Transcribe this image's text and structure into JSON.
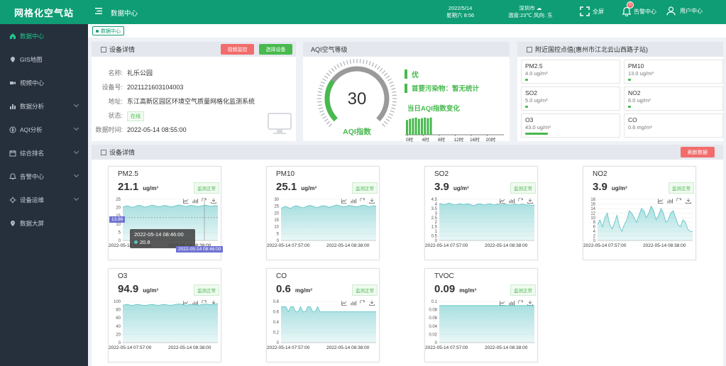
{
  "app": {
    "title": "网格化空气站"
  },
  "sidebar": {
    "items": [
      {
        "label": "数据中心",
        "icon": "home-icon",
        "active": true,
        "arrow": false
      },
      {
        "label": "GIS地图",
        "icon": "map-icon",
        "active": false,
        "arrow": false
      },
      {
        "label": "视频中心",
        "icon": "video-icon",
        "active": false,
        "arrow": false
      },
      {
        "label": "数据分析",
        "icon": "bar-chart-icon",
        "active": false,
        "arrow": true
      },
      {
        "label": "AQI分析",
        "icon": "compass-icon",
        "active": false,
        "arrow": true
      },
      {
        "label": "综合排名",
        "icon": "calendar-icon",
        "active": false,
        "arrow": true
      },
      {
        "label": "告警中心",
        "icon": "bell-icon",
        "active": false,
        "arrow": true
      },
      {
        "label": "设备运维",
        "icon": "settings-icon",
        "active": false,
        "arrow": true
      },
      {
        "label": "数据大屏",
        "icon": "location-icon",
        "active": false,
        "arrow": false
      }
    ]
  },
  "topbar": {
    "page_title": "数据中心",
    "date": "2022/5/14",
    "weekday_time": "星期六 8:56",
    "city": "深圳市",
    "weather": "温度:23℃ 风向: 东",
    "fullscreen_label": "全屏",
    "alarm_label": "告警中心",
    "alarm_count": "0",
    "user_label": "用户中心"
  },
  "breadcrumb": {
    "label": "数据中心"
  },
  "device": {
    "title": "设备详情",
    "btn_video": "视频监控",
    "btn_select": "选择设备",
    "rows": [
      {
        "k": "名称:",
        "v": "礼乐公园"
      },
      {
        "k": "设备号:",
        "v": "2021121603104003"
      },
      {
        "k": "地址:",
        "v": "东江高新区园区环境空气质量网格化监测系统"
      },
      {
        "k": "状态:",
        "v": "在线"
      },
      {
        "k": "数据时间:",
        "v": "2022-05-14 08:55:00"
      }
    ]
  },
  "aqi": {
    "title": "AQI空气等级",
    "value": "30",
    "label": "AQI指数",
    "level": "优",
    "pollutant": "首要污染物：暂无统计",
    "today_title": "当日AQI指数变化",
    "today_values": [
      24,
      26,
      27,
      28,
      26,
      27,
      28,
      27,
      28
    ],
    "ticks": [
      "0时",
      "4时",
      "8时",
      "12时",
      "16时",
      "20时"
    ],
    "gauge_fraction": 0.3,
    "colors": {
      "green": "#48b94e",
      "gray": "#9a9a9a"
    }
  },
  "national": {
    "title": "附近国控点值(惠州市江北云山西路子站)",
    "items": [
      {
        "name": "PM2.5",
        "value": "4.0 ug/m³",
        "level": 0.03
      },
      {
        "name": "PM10",
        "value": "13.0 ug/m³",
        "level": 0.03
      },
      {
        "name": "SO2",
        "value": "5.0 ug/m³",
        "level": 0.03
      },
      {
        "name": "NO2",
        "value": "6.0 ug/m³",
        "level": 0.03
      },
      {
        "name": "O3",
        "value": "43.0 ug/m³",
        "level": 0.25
      },
      {
        "name": "CO",
        "value": "0.6 mg/m³",
        "level": 0.0
      }
    ]
  },
  "details": {
    "title": "设备详情",
    "refresh": "刷新数据",
    "status_label": "监测正常",
    "x_start": "2022-05-14 07:57:00",
    "x_end": "2022-05-14 08:38:00",
    "tooltip": {
      "time": "2022-05-14 08:46:00",
      "value": "20.8",
      "marker": "13.86",
      "axis_time": "2022-05-14 08:46:00"
    }
  },
  "chart_data": [
    {
      "type": "area",
      "name": "PM2.5",
      "value": "21.1",
      "unit": "ug/m³",
      "yticks": [
        "0",
        "5",
        "10",
        "15",
        "20",
        "25"
      ],
      "ylim": [
        0,
        25
      ],
      "values": [
        20.2,
        20.8,
        21.0,
        20.5,
        20.1,
        20.6,
        21.2,
        21.4,
        20.8,
        20.3,
        20.6,
        21.0,
        21.5,
        21.2,
        20.7,
        20.5,
        20.9,
        21.3,
        21.1,
        20.6,
        20.4,
        20.8,
        21.2,
        21.6,
        21.3,
        20.9,
        20.7,
        21.0,
        21.4,
        21.1,
        20.8,
        20.6,
        21.0,
        21.3,
        21.5,
        21.1,
        20.8,
        21.0,
        21.2,
        21.1
      ]
    },
    {
      "type": "area",
      "name": "PM10",
      "value": "25.1",
      "unit": "ug/m³",
      "yticks": [
        "0",
        "5",
        "10",
        "15",
        "20",
        "25",
        "30"
      ],
      "ylim": [
        0,
        30
      ],
      "values": [
        23.5,
        24.2,
        24.8,
        23.9,
        23.4,
        24.6,
        25.3,
        25.0,
        24.2,
        23.8,
        24.4,
        25.2,
        25.6,
        24.9,
        24.3,
        24.0,
        24.7,
        25.4,
        25.2,
        24.6,
        24.1,
        24.8,
        25.5,
        25.9,
        25.3,
        24.7,
        24.5,
        25.0,
        25.6,
        25.2,
        24.8,
        24.4,
        24.9,
        25.5,
        25.8,
        25.2,
        24.7,
        24.9,
        25.3,
        25.1
      ]
    },
    {
      "type": "area",
      "name": "SO2",
      "value": "3.9",
      "unit": "ug/m³",
      "yticks": [
        "0",
        "0.5",
        "1",
        "1.5",
        "2",
        "2.5",
        "3",
        "3.5",
        "4",
        "4.5"
      ],
      "ylim": [
        0,
        4.5
      ],
      "values": [
        4.0,
        4.0,
        3.9,
        4.0,
        4.1,
        4.0,
        3.9,
        3.9,
        4.0,
        4.0,
        3.9,
        4.0,
        4.0,
        3.9,
        3.8,
        3.9,
        4.0,
        4.0,
        3.9,
        3.9,
        4.0,
        4.0,
        3.9,
        3.9,
        4.0,
        3.9,
        3.9,
        4.0,
        3.9,
        3.9,
        3.9,
        4.0,
        3.9,
        3.9,
        4.0,
        3.9,
        3.9,
        3.9,
        3.8,
        3.9
      ]
    },
    {
      "type": "area",
      "name": "NO2",
      "value": "3.9",
      "unit": "ug/m³",
      "yticks": [
        "0",
        "2",
        "4",
        "6",
        "8",
        "10",
        "12",
        "14",
        "16",
        "18"
      ],
      "ylim": [
        0,
        18
      ],
      "values": [
        7,
        9,
        6,
        10,
        12,
        7,
        5,
        8,
        11,
        6,
        4,
        7,
        9,
        13,
        12,
        10,
        8,
        11,
        14,
        13,
        10,
        12,
        15,
        13,
        9,
        11,
        14,
        12,
        8,
        9,
        12,
        13,
        10,
        7,
        6,
        9,
        8,
        5,
        4,
        3.9
      ]
    },
    {
      "type": "area",
      "name": "O3",
      "value": "94.9",
      "unit": "ug/m³",
      "yticks": [
        "0",
        "20",
        "40",
        "60",
        "80",
        "100"
      ],
      "ylim": [
        0,
        100
      ],
      "values": [
        91,
        92,
        93,
        91,
        90,
        92,
        93,
        92,
        91,
        90,
        91,
        92,
        93,
        92,
        91,
        91,
        92,
        93,
        92,
        91,
        91,
        92,
        93,
        94,
        93,
        92,
        91,
        92,
        93,
        92,
        92,
        91,
        92,
        93,
        94,
        93,
        92,
        93,
        94,
        94.9
      ]
    },
    {
      "type": "area",
      "name": "CO",
      "value": "0.6",
      "unit": "mg/m³",
      "yticks": [
        "0",
        "0.2",
        "0.4",
        "0.6",
        "0.8"
      ],
      "ylim": [
        0,
        0.8
      ],
      "values": [
        0.7,
        0.7,
        0.7,
        0.6,
        0.7,
        0.7,
        0.6,
        0.6,
        0.7,
        0.6,
        0.6,
        0.7,
        0.7,
        0.6,
        0.6,
        0.7,
        0.6,
        0.6,
        0.6,
        0.6,
        0.6,
        0.6,
        0.6,
        0.6,
        0.6,
        0.6,
        0.6,
        0.6,
        0.6,
        0.6,
        0.6,
        0.6,
        0.6,
        0.6,
        0.6,
        0.6,
        0.6,
        0.6,
        0.6,
        0.6
      ]
    },
    {
      "type": "area",
      "name": "TVOC",
      "value": "0.09",
      "unit": "mg/m³",
      "yticks": [
        "0",
        "0.02",
        "0.04",
        "0.06",
        "0.08",
        "0.1"
      ],
      "ylim": [
        0,
        0.1
      ],
      "values": [
        0.09,
        0.09,
        0.09,
        0.09,
        0.09,
        0.09,
        0.09,
        0.09,
        0.09,
        0.09,
        0.09,
        0.09,
        0.09,
        0.09,
        0.09,
        0.09,
        0.09,
        0.09,
        0.09,
        0.09,
        0.09,
        0.09,
        0.09,
        0.09,
        0.09,
        0.09,
        0.09,
        0.09,
        0.09,
        0.09,
        0.09,
        0.09,
        0.09,
        0.09,
        0.09,
        0.09,
        0.09,
        0.09,
        0.09,
        0.09
      ]
    }
  ],
  "colors": {
    "brand": "#0e9d74",
    "sidebar": "#26303d",
    "area_fill": "#a9dfe0",
    "area_line": "#5bc2c4",
    "status_green": "#48b94e"
  }
}
